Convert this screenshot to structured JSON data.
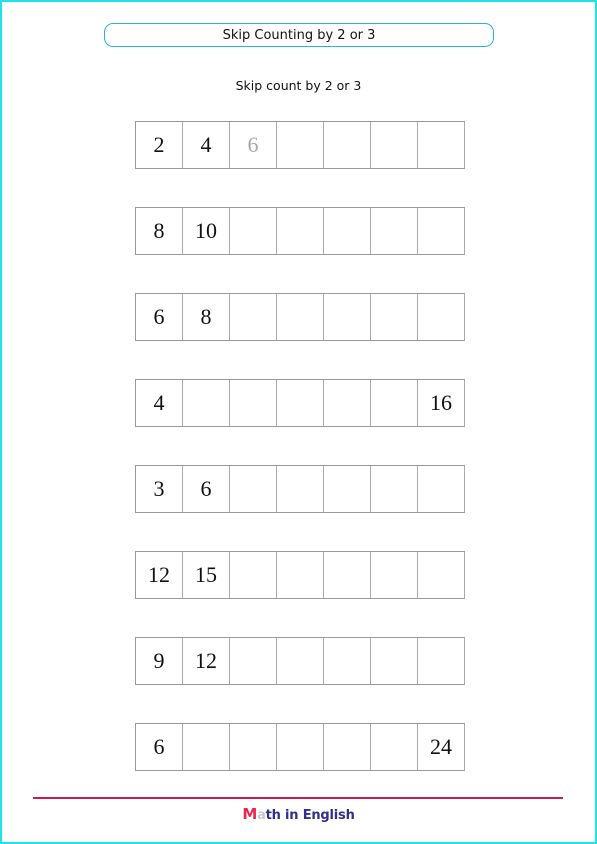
{
  "header": {
    "title": "Skip Counting by 2 or 3",
    "subtitle": "Skip count by 2 or 3"
  },
  "colors": {
    "page_border": "#1ee3ea",
    "title_border": "#2bb3e0",
    "footer_line": "#c8195a",
    "logo_m": "#e8264e",
    "logo_text": "#2e2f8f",
    "hint_number": "#a8a8a8"
  },
  "exercises": [
    {
      "cells": [
        "2",
        "4",
        "6",
        "",
        "",
        "",
        ""
      ],
      "hint_index": 2
    },
    {
      "cells": [
        "8",
        "10",
        "",
        "",
        "",
        "",
        ""
      ]
    },
    {
      "cells": [
        "6",
        "8",
        "",
        "",
        "",
        "",
        ""
      ]
    },
    {
      "cells": [
        "4",
        "",
        "",
        "",
        "",
        "",
        "16"
      ]
    },
    {
      "cells": [
        "3",
        "6",
        "",
        "",
        "",
        "",
        ""
      ]
    },
    {
      "cells": [
        "12",
        "15",
        "",
        "",
        "",
        "",
        ""
      ]
    },
    {
      "cells": [
        "9",
        "12",
        "",
        "",
        "",
        "",
        ""
      ]
    },
    {
      "cells": [
        "6",
        "",
        "",
        "",
        "",
        "",
        "24"
      ]
    }
  ],
  "footer": {
    "logo_first": "M",
    "logo_second": "a",
    "logo_rest": "th in English"
  }
}
